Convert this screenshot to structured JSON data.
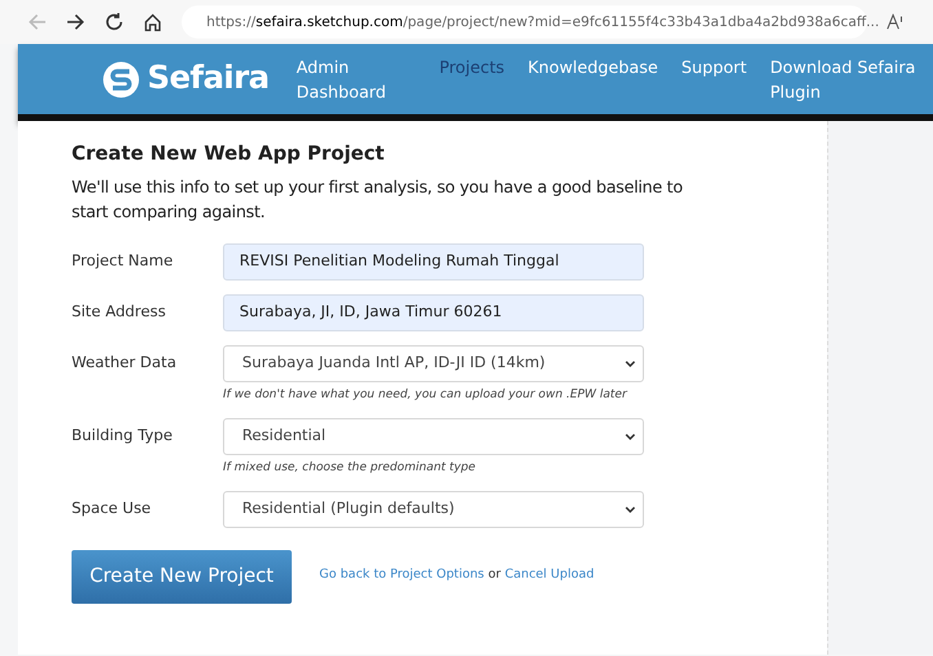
{
  "browser": {
    "url_prefix": "https://",
    "url_domain": "sefaira.sketchup.com",
    "url_rest": "/page/project/new?mid=e9fc61155f4c33b43a1dba4a2bd938a6caff..."
  },
  "header": {
    "logo_text": "Sefaira",
    "nav": [
      {
        "label": "Admin Dashboard",
        "selected": false
      },
      {
        "label": "Projects",
        "selected": true
      },
      {
        "label": "Knowledgebase",
        "selected": false
      },
      {
        "label": "Support",
        "selected": false
      },
      {
        "label": "Download Sefaira Plugin",
        "selected": false
      }
    ]
  },
  "form": {
    "title": "Create New Web App Project",
    "intro": "We'll use this info to set up your first analysis, so you have a good baseline to start comparing against.",
    "fields": [
      {
        "label": "Project Name",
        "kind": "input",
        "value": "REVISI Penelitian Modeling Rumah Tinggal"
      },
      {
        "label": "Site Address",
        "kind": "input",
        "value": "Surabaya, JI, ID, Jawa Timur 60261"
      },
      {
        "label": "Weather Data",
        "kind": "select",
        "value": "Surabaya Juanda Intl AP, ID-JI ID (14km)",
        "hint": "If we don't have what you need, you can upload your own .EPW later"
      },
      {
        "label": "Building Type",
        "kind": "select",
        "value": "Residential",
        "hint": "If mixed use, choose the predominant type"
      },
      {
        "label": "Space Use",
        "kind": "select",
        "value": "Residential (Plugin defaults)"
      }
    ],
    "submit": "Create New Project",
    "back_link": "Go back to Project Options",
    "or_text": "or",
    "cancel_link": "Cancel Upload"
  }
}
